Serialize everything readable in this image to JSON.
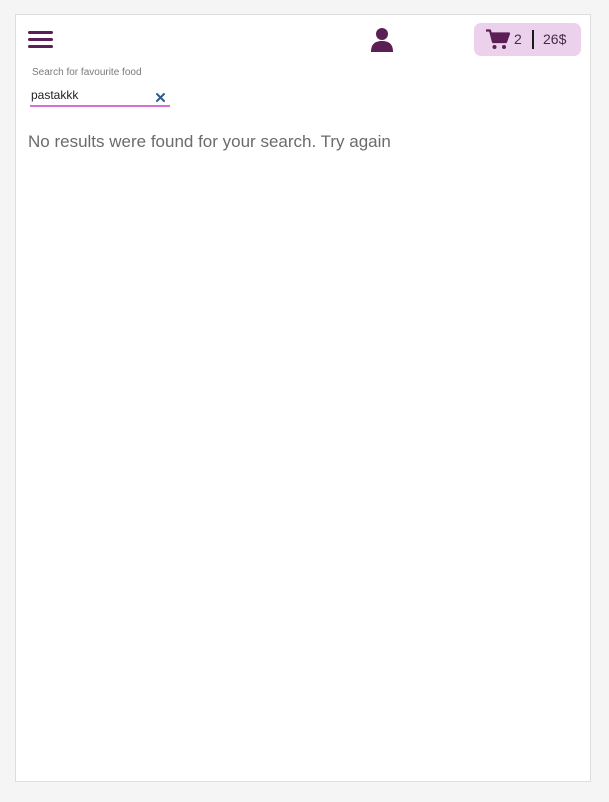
{
  "header": {
    "menu_icon": "hamburger-menu-icon",
    "profile_icon": "user-icon",
    "cart": {
      "icon": "shopping-cart-icon",
      "count": "2",
      "total": "26$"
    }
  },
  "search": {
    "label": "Search for favourite food",
    "value": "pastakkk",
    "clear_icon": "close-icon"
  },
  "results": {
    "message": "No results were found for your search. Try again"
  },
  "colors": {
    "brand": "#5b1f56",
    "cart_background": "#ecd1ec",
    "search_underline": "#d86fd8",
    "clear_icon": "#2f5d8a"
  }
}
